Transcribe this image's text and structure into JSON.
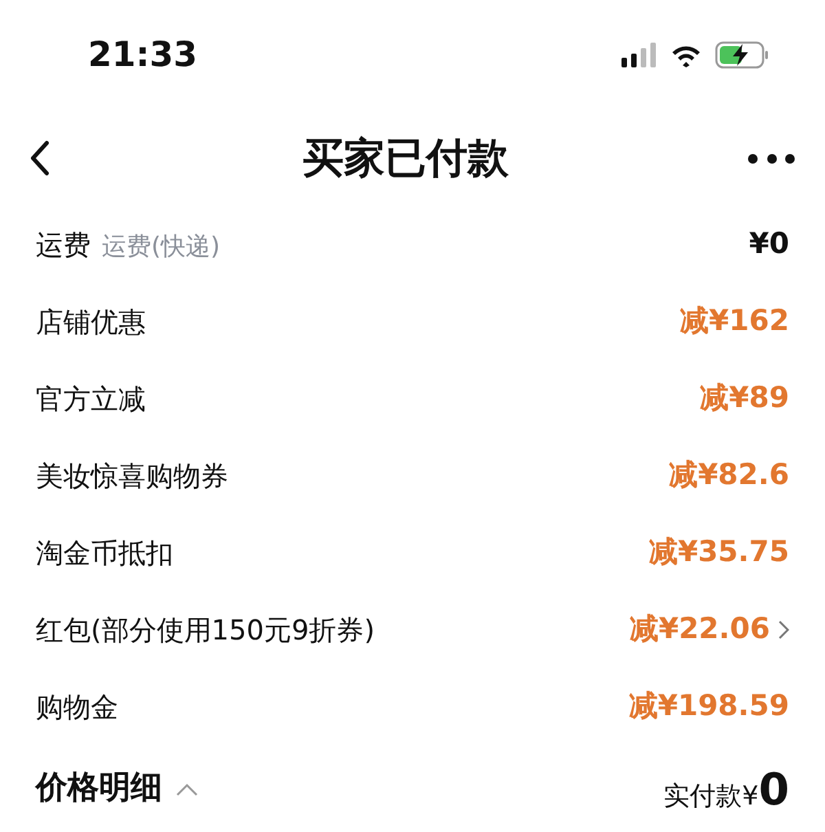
{
  "status_bar": {
    "time": "21:33"
  },
  "nav": {
    "title": "买家已付款"
  },
  "rows": [
    {
      "kind": "plain",
      "label": "运费",
      "sublabel": "运费(快递)",
      "amount": "¥0",
      "has_link": false
    },
    {
      "kind": "discount",
      "label": "店铺优惠",
      "amount": "减¥162",
      "has_link": false
    },
    {
      "kind": "discount",
      "label": "官方立减",
      "amount": "减¥89",
      "has_link": false
    },
    {
      "kind": "discount",
      "label": "美妆惊喜购物券",
      "amount": "减¥82.6",
      "has_link": false
    },
    {
      "kind": "discount",
      "label": "淘金币抵扣",
      "amount": "减¥35.75",
      "has_link": false
    },
    {
      "kind": "discount",
      "label": "红包(部分使用150元9折券)",
      "amount": "减¥22.06",
      "has_link": true
    },
    {
      "kind": "discount",
      "label": "购物金",
      "amount": "减¥198.59",
      "has_link": false
    }
  ],
  "footer": {
    "title": "价格明细",
    "expanded": true,
    "paid_label": "实付款¥",
    "paid_amount": "0"
  }
}
